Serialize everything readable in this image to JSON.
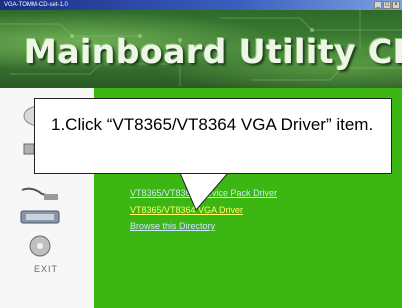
{
  "window": {
    "title": "VGA-TOMM-CD-set-1.0"
  },
  "banner": {
    "title": "Mainboard Utility CD"
  },
  "sidebar": {
    "exit_label": "EXIT"
  },
  "main": {
    "links": [
      "VT8365/VT8364 Service Pack Driver",
      "VT8365/VT8364 VGA Driver",
      "Browse this Directory"
    ]
  },
  "callout": {
    "text": "1.Click “VT8365/VT8364 VGA Driver” item."
  },
  "colors": {
    "banner": "#3f7f35",
    "main_panel": "#3bb613",
    "selected_link": "#ffff66",
    "link": "#cfe6ff"
  },
  "icons": [
    "cd-icon",
    "tools-icon",
    "document-icon",
    "bios-icon",
    "disc-icon"
  ]
}
